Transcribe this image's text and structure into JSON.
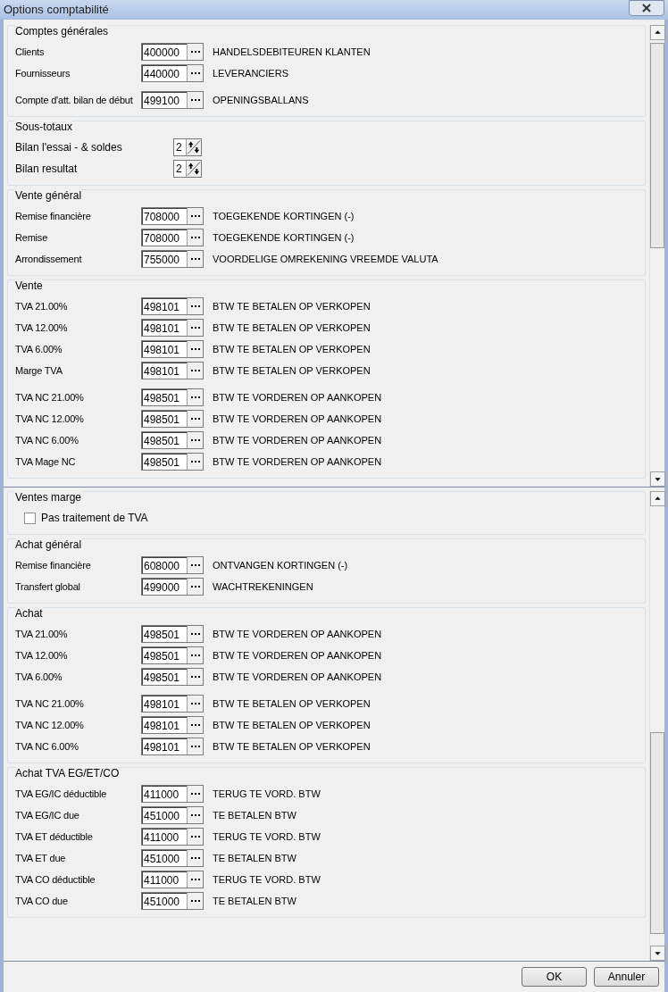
{
  "window": {
    "title": "Options comptabilité"
  },
  "panes": [
    {
      "groups": [
        {
          "title": "Comptes générales",
          "blocks": [
            [
              {
                "kind": "account",
                "label": "Clients",
                "code": "400000",
                "description": "HANDELSDEBITEUREN KLANTEN"
              },
              {
                "kind": "account",
                "label": "Fournisseurs",
                "code": "440000",
                "description": "LEVERANCIERS"
              }
            ],
            [
              {
                "kind": "account",
                "label": "Compte d'att. bilan de début",
                "code": "499100",
                "description": "OPENINGSBALLANS"
              }
            ]
          ]
        },
        {
          "title": "Sous-totaux",
          "blocks": [
            [
              {
                "kind": "spin",
                "label": "Bilan l'essai - & soldes",
                "value": "2"
              },
              {
                "kind": "spin",
                "label": "Bilan resultat",
                "value": "2"
              }
            ]
          ]
        },
        {
          "title": "Vente général",
          "blocks": [
            [
              {
                "kind": "account",
                "label": "Remise financière",
                "code": "708000",
                "description": "TOEGEKENDE KORTINGEN (-)"
              },
              {
                "kind": "account",
                "label": "Remise",
                "code": "708000",
                "description": "TOEGEKENDE KORTINGEN (-)"
              },
              {
                "kind": "account",
                "label": "Arrondissement",
                "code": "755000",
                "description": "VOORDELIGE OMREKENING VREEMDE VALUTA"
              }
            ]
          ]
        },
        {
          "title": "Vente",
          "blocks": [
            [
              {
                "kind": "account",
                "label": "TVA 21.00%",
                "code": "498101",
                "description": "BTW TE BETALEN OP VERKOPEN"
              },
              {
                "kind": "account",
                "label": "TVA 12.00%",
                "code": "498101",
                "description": "BTW TE BETALEN OP VERKOPEN"
              },
              {
                "kind": "account",
                "label": "TVA 6.00%",
                "code": "498101",
                "description": "BTW TE BETALEN OP VERKOPEN"
              },
              {
                "kind": "account",
                "label": "Marge TVA",
                "code": "498101",
                "description": "BTW TE BETALEN OP VERKOPEN"
              }
            ],
            [
              {
                "kind": "account",
                "label": "TVA NC 21.00%",
                "code": "498501",
                "description": "BTW TE VORDEREN OP AANKOPEN"
              },
              {
                "kind": "account",
                "label": "TVA NC 12.00%",
                "code": "498501",
                "description": "BTW TE VORDEREN OP AANKOPEN"
              },
              {
                "kind": "account",
                "label": "TVA NC 6.00%",
                "code": "498501",
                "description": "BTW TE VORDEREN OP AANKOPEN"
              },
              {
                "kind": "account",
                "label": "TVA Mage NC",
                "code": "498501",
                "description": "BTW TE VORDEREN OP AANKOPEN"
              }
            ]
          ]
        }
      ]
    },
    {
      "groups": [
        {
          "title": "Ventes marge",
          "blocks": [
            [
              {
                "kind": "check",
                "label": "Pas traitement de TVA",
                "checked": false
              }
            ]
          ]
        },
        {
          "title": "Achat général",
          "blocks": [
            [
              {
                "kind": "account",
                "label": "Remise financière",
                "code": "608000",
                "description": "ONTVANGEN KORTINGEN (-)"
              },
              {
                "kind": "account",
                "label": "Transfert global",
                "code": "499000",
                "description": "WACHTREKENINGEN"
              }
            ]
          ]
        },
        {
          "title": "Achat",
          "blocks": [
            [
              {
                "kind": "account",
                "label": "TVA 21.00%",
                "code": "498501",
                "description": "BTW TE VORDEREN OP AANKOPEN"
              },
              {
                "kind": "account",
                "label": "TVA 12.00%",
                "code": "498501",
                "description": "BTW TE VORDEREN OP AANKOPEN"
              },
              {
                "kind": "account",
                "label": "TVA 6.00%",
                "code": "498501",
                "description": "BTW TE VORDEREN OP AANKOPEN"
              }
            ],
            [
              {
                "kind": "account",
                "label": "TVA NC 21.00%",
                "code": "498101",
                "description": "BTW TE BETALEN OP VERKOPEN"
              },
              {
                "kind": "account",
                "label": "TVA NC 12.00%",
                "code": "498101",
                "description": "BTW TE BETALEN OP VERKOPEN"
              },
              {
                "kind": "account",
                "label": "TVA NC 6.00%",
                "code": "498101",
                "description": "BTW TE BETALEN OP VERKOPEN"
              }
            ]
          ]
        },
        {
          "title": "Achat TVA EG/ET/CO",
          "blocks": [
            [
              {
                "kind": "account",
                "label": "TVA EG/IC déductible",
                "code": "411000",
                "description": "TERUG TE VORD. BTW"
              },
              {
                "kind": "account",
                "label": "TVA EG/IC due",
                "code": "451000",
                "description": "TE BETALEN BTW"
              },
              {
                "kind": "account",
                "label": "TVA ET déductible",
                "code": "411000",
                "description": "TERUG TE VORD. BTW"
              },
              {
                "kind": "account",
                "label": "TVA ET due",
                "code": "451000",
                "description": "TE BETALEN BTW"
              },
              {
                "kind": "account",
                "label": "TVA CO déductible",
                "code": "411000",
                "description": "TERUG TE VORD. BTW"
              },
              {
                "kind": "account",
                "label": "TVA CO due",
                "code": "451000",
                "description": "TE BETALEN BTW"
              }
            ]
          ]
        }
      ]
    }
  ],
  "buttons": [
    {
      "label": "OK"
    },
    {
      "label": "Annuler"
    }
  ]
}
